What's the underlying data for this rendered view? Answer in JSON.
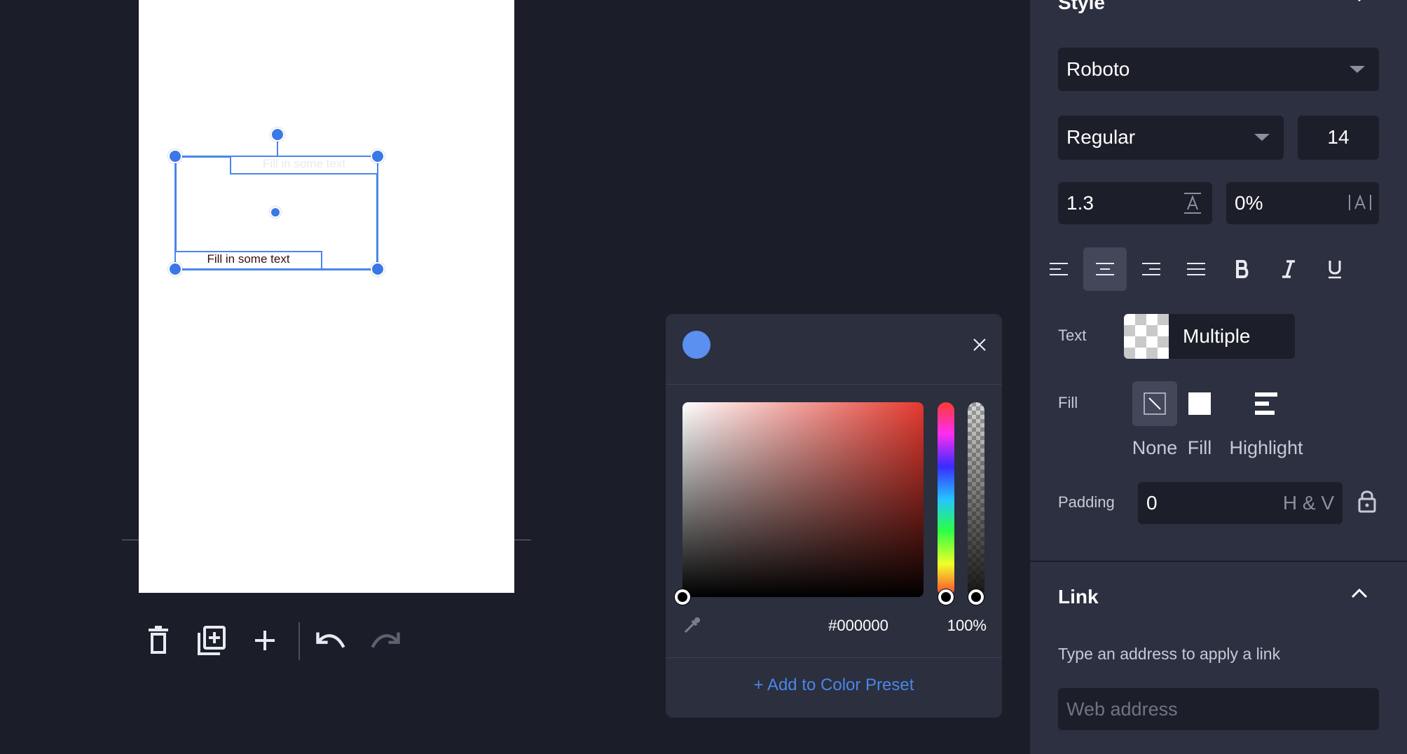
{
  "canvas": {
    "text_box_top": "Fill in some text",
    "text_box_bottom": "Fill in some text"
  },
  "toolbar": {
    "icons": [
      "delete-icon",
      "duplicate-page-icon",
      "add-icon",
      "undo-icon",
      "redo-icon"
    ]
  },
  "color_picker": {
    "hex": "#000000",
    "alpha": "100%",
    "add_preset": "+ Add to Color Preset",
    "current_color": "#5b8ff0"
  },
  "style_panel": {
    "section_title": "Style",
    "font_family": "Roboto",
    "font_weight": "Regular",
    "font_size": "14",
    "line_height": "1.3",
    "letter_spacing": "0%",
    "text_label": "Text",
    "text_color_value": "Multiple",
    "fill_label": "Fill",
    "fill_options": [
      "None",
      "Fill",
      "Highlight"
    ],
    "padding_label": "Padding",
    "padding_value": "0",
    "padding_suffix": "H & V"
  },
  "link_panel": {
    "title": "Link",
    "hint": "Type an address to apply a link",
    "placeholder": "Web address"
  },
  "colors": {
    "accent": "#4a86e8",
    "background": "#1b1d28",
    "panel": "#2c3040"
  }
}
